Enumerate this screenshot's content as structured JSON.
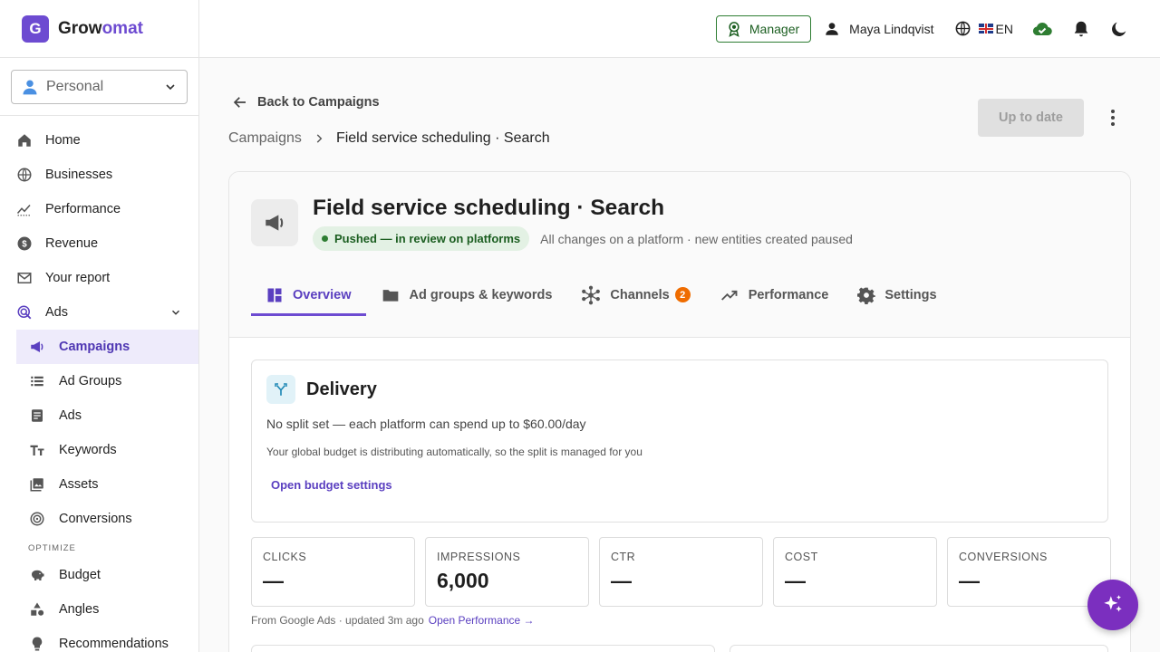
{
  "brand": {
    "logo_letter": "G",
    "name_part1": "Grow",
    "name_part2": "omat"
  },
  "account": {
    "label": "Personal"
  },
  "sidebar": {
    "items": [
      {
        "label": "Home",
        "icon": "home-icon"
      },
      {
        "label": "Businesses",
        "icon": "globe-icon"
      },
      {
        "label": "Performance",
        "icon": "trend-icon"
      },
      {
        "label": "Revenue",
        "icon": "dollar-icon"
      },
      {
        "label": "Your report",
        "icon": "report-icon"
      },
      {
        "label": "Ads",
        "icon": "ads-icon"
      }
    ],
    "ads_children": [
      {
        "label": "Campaigns",
        "icon": "megaphone-icon",
        "active": true
      },
      {
        "label": "Ad Groups",
        "icon": "list-icon"
      },
      {
        "label": "Ads",
        "icon": "document-icon"
      },
      {
        "label": "Keywords",
        "icon": "text-icon"
      },
      {
        "label": "Assets",
        "icon": "images-icon"
      },
      {
        "label": "Conversions",
        "icon": "target-icon"
      }
    ],
    "optimize_label": "OPTIMIZE",
    "optimize_items": [
      {
        "label": "Budget",
        "icon": "piggy-bank-icon"
      },
      {
        "label": "Angles",
        "icon": "shapes-icon"
      },
      {
        "label": "Recommendations",
        "icon": "lightbulb-icon"
      }
    ]
  },
  "topbar": {
    "manager_label": "Manager",
    "user_name": "Maya Lindqvist",
    "language": "EN"
  },
  "page": {
    "back_label": "Back to Campaigns",
    "status_button": "Up to date",
    "breadcrumb": {
      "parent": "Campaigns",
      "current": "Field service scheduling · Search"
    },
    "campaign_title": "Field service scheduling · Search",
    "status_pill": "Pushed — in review on platforms",
    "status_note": "All changes on a platform · new entities created paused",
    "tabs": [
      {
        "label": "Overview",
        "icon": "dashboard-icon",
        "active": true
      },
      {
        "label": "Ad groups & keywords",
        "icon": "folder-icon"
      },
      {
        "label": "Channels",
        "icon": "hub-icon",
        "badge": "2"
      },
      {
        "label": "Performance",
        "icon": "trend-icon"
      },
      {
        "label": "Settings",
        "icon": "gear-icon"
      }
    ],
    "delivery": {
      "title": "Delivery",
      "line": "No split set — each platform can spend up to $60.00/day",
      "sub": "Your global budget is distributing automatically, so the split is managed for you",
      "link": "Open budget settings"
    },
    "stats": [
      {
        "label": "CLICKS",
        "value": "—"
      },
      {
        "label": "IMPRESSIONS",
        "value": "6,000"
      },
      {
        "label": "CTR",
        "value": "—"
      },
      {
        "label": "COST",
        "value": "—"
      },
      {
        "label": "CONVERSIONS",
        "value": "—"
      }
    ],
    "source_note": "From Google Ads · updated 3m ago",
    "performance_link": "Open Performance →"
  },
  "colors": {
    "brand": "#6d4bd1",
    "fab": "#7b2fbf",
    "status_green": "#2e7d32",
    "badge_orange": "#ef6c00"
  }
}
